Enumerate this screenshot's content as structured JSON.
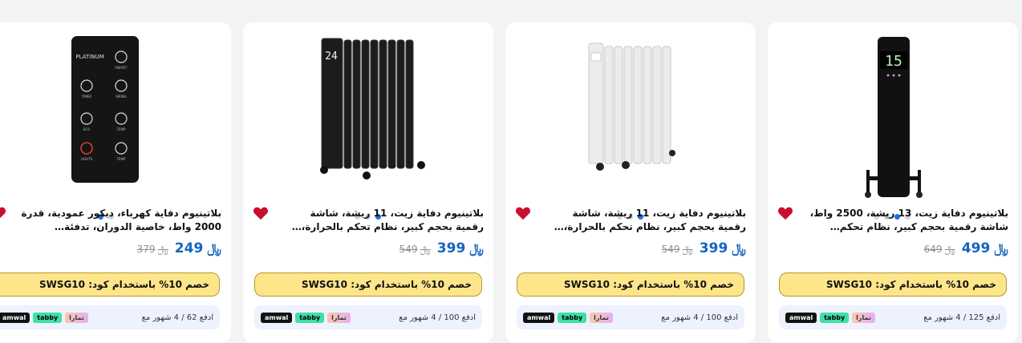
{
  "currency_symbol": "﷼",
  "promo_text": "خصم 10% باستخدام كود: SWSG10",
  "bnpl_logos": [
    "amwal",
    "tabby",
    "تمارا"
  ],
  "products": [
    {
      "title": "بلاتينيوم دفاية زيت، 13 ريشة، 2500 واط، شاشة رقمية بحجم كبير، نظام تحكم بالحرارة، لوحة تحك...",
      "price": "499",
      "old_price": "649",
      "installment": "ادفع 125 / 4 شهور مع",
      "image": "black-tower-heater-15",
      "dots_active": 2,
      "dots_count": 4
    },
    {
      "title": "بلاتينيوم دفاية زيت، 11 ريشة، شاشة رقمية بحجم كبير، نظام تحكم بالحرارة، لوحة تحكم لمس، ايب...",
      "price": "399",
      "old_price": "549",
      "installment": "ادفع 100 / 4 شهور مع",
      "image": "white-oil-heater",
      "dots_active": 2,
      "dots_count": 3
    },
    {
      "title": "بلاتينيوم دفاية زيت، 11 ريشة، شاشة رقمية بحجم كبير، نظام تحكم بالحرارة، لوحة تحكم لمس، اسو...",
      "price": "399",
      "old_price": "549",
      "installment": "ادفع 100 / 4 شهور مع",
      "image": "black-oil-heater-24",
      "dots_active": 2,
      "dots_count": 3
    },
    {
      "title": "بلاتينيوم دفاية كهرباء، ديكور عمودية، قدرة 2000 واط، خاصية الدوران، تدفئة سيراميك، وحدة تحكم...",
      "price": "249",
      "old_price": "379",
      "installment": "ادفع 62 / 4 شهور مع",
      "image": "remote-control-platinum",
      "dots_active": 0,
      "dots_count": 2
    }
  ],
  "remote_brand": "PLATINUM",
  "remote_labels": [
    "ON/OFF",
    "TIMER",
    "SWING",
    "ECO",
    "TEMP",
    "LIGHTS",
    "TEMP"
  ],
  "heater_displays": [
    "15",
    "24"
  ]
}
